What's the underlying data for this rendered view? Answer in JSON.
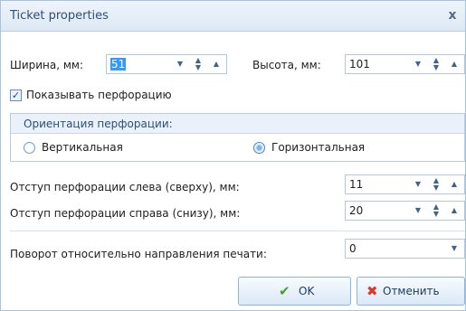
{
  "window": {
    "title": "Ticket properties",
    "close_symbol": "x"
  },
  "size": {
    "width_label": "Ширина, мм:",
    "width_value": "51",
    "height_label": "Высота, мм:",
    "height_value": "101"
  },
  "perforation": {
    "show_label": "Показывать перфорацию",
    "show_checked": true,
    "orientation": {
      "group_label": "Ориентация перфорации:",
      "vertical_label": "Вертикальная",
      "horizontal_label": "Горизонтальная",
      "selected": "horizontal"
    },
    "left_offset_label": "Отступ перфорации слева (сверху), мм:",
    "left_offset_value": "11",
    "right_offset_label": "Отступ перфорации справа (снизу), мм:",
    "right_offset_value": "20"
  },
  "rotation": {
    "label": "Поворот относительно направления печати:",
    "value": "0"
  },
  "buttons": {
    "ok_label": "OK",
    "cancel_label": "Отменить"
  },
  "colors": {
    "accent": "#3399ff",
    "ok_icon": "#3fa22f",
    "cancel_icon": "#d9382a"
  },
  "icons": {
    "ok": "check-icon",
    "cancel": "cross-icon"
  }
}
